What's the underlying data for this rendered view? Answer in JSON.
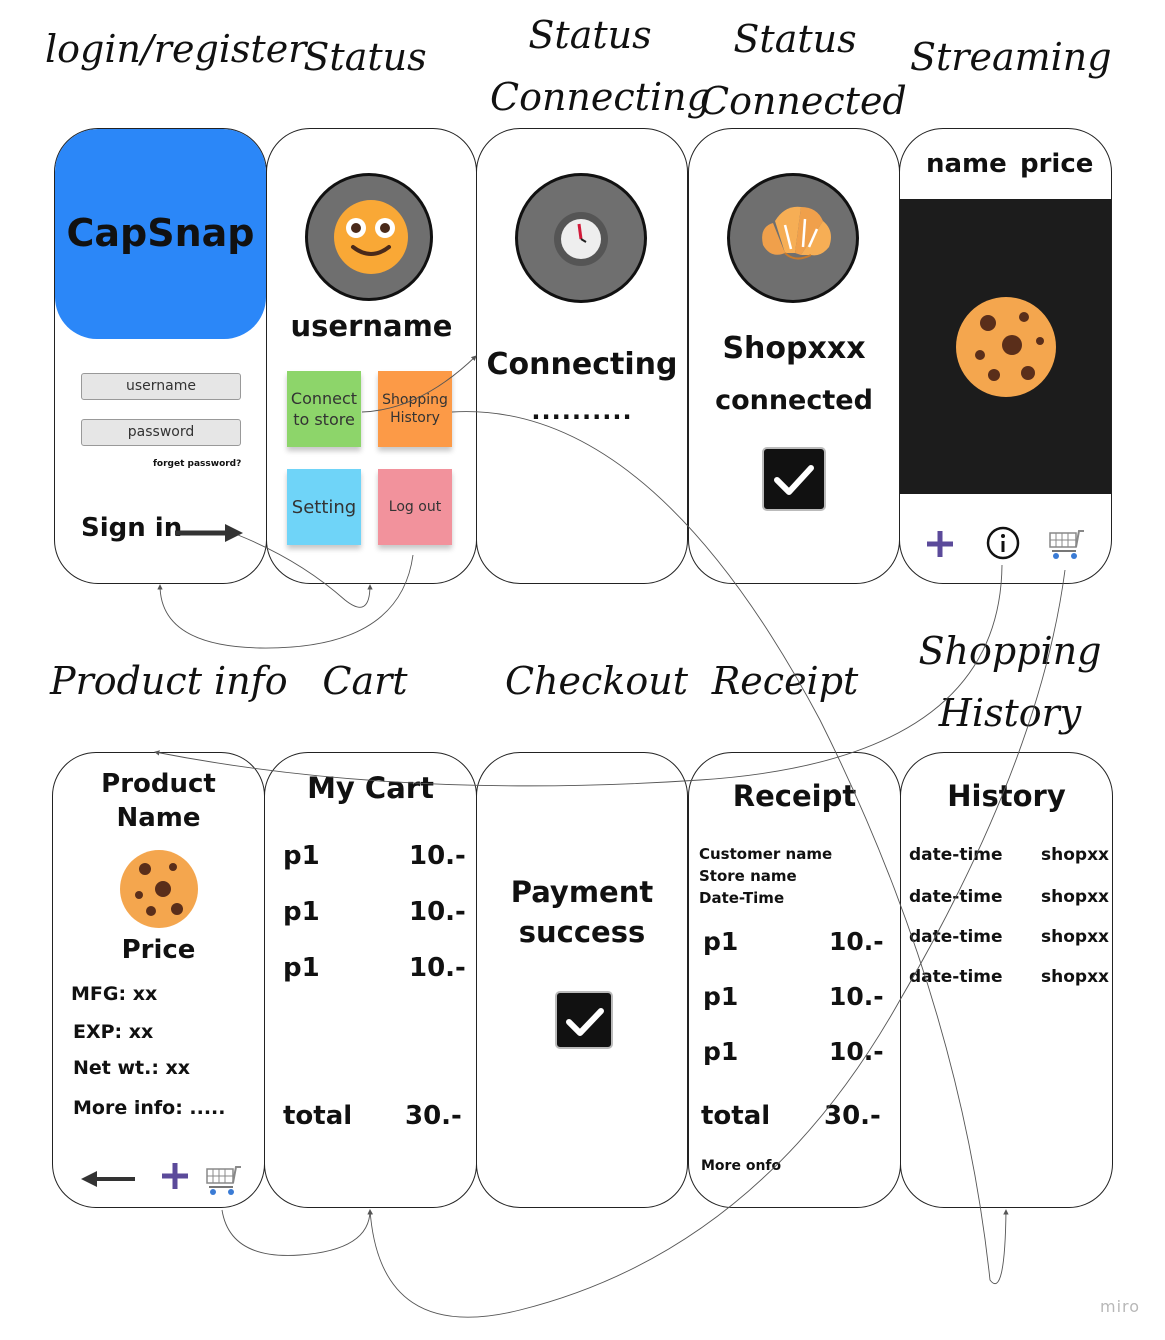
{
  "titles": {
    "login": "login/register",
    "status": "Status",
    "connecting": [
      "Status",
      "Connecting"
    ],
    "connected": [
      "Status",
      "Connected"
    ],
    "streaming": "Streaming",
    "product_info": "Product info",
    "cart": "Cart",
    "checkout": "Checkout",
    "receipt": "Receipt",
    "history": [
      "Shopping",
      "History"
    ]
  },
  "login": {
    "brand": "CapSnap",
    "username_placeholder": "username",
    "password_placeholder": "password",
    "forget": "forget password?",
    "sign_in": "Sign in",
    "brand_color": "#2b87f8"
  },
  "status": {
    "username": "username",
    "notes": [
      {
        "label_lines": [
          "Connect",
          "to store"
        ],
        "color": "#8dd56a"
      },
      {
        "label_lines": [
          "Shopping",
          "History"
        ],
        "color": "#fc9a47"
      },
      {
        "label_lines": [
          "Setting"
        ],
        "color": "#6fd4f8"
      },
      {
        "label_lines": [
          "Log out"
        ],
        "color": "#f2929c"
      }
    ]
  },
  "connecting": {
    "text": "Connecting",
    "dots": ".........."
  },
  "connected": {
    "shop": "Shopxxx",
    "text": "connected"
  },
  "streaming": {
    "name": "name",
    "price": "price",
    "icons": [
      "plus-icon",
      "info-icon",
      "cart-icon"
    ]
  },
  "product": {
    "title_lines": [
      "Product",
      "Name"
    ],
    "price": "Price",
    "mfg": "MFG: xx",
    "exp": "EXP: xx",
    "net": "Net wt.: xx",
    "more": "More info: ....."
  },
  "cart": {
    "title": "My Cart",
    "items": [
      {
        "name": "p1",
        "price": "10.-"
      },
      {
        "name": "p1",
        "price": "10.-"
      },
      {
        "name": "p1",
        "price": "10.-"
      }
    ],
    "total_label": "total",
    "total_value": "30.-"
  },
  "checkout": {
    "lines": [
      "Payment",
      "success"
    ]
  },
  "receipt": {
    "title": "Receipt",
    "meta": [
      "Customer name",
      "Store name",
      "Date-Time"
    ],
    "items": [
      {
        "name": "p1",
        "price": "10.-"
      },
      {
        "name": "p1",
        "price": "10.-"
      },
      {
        "name": "p1",
        "price": "10.-"
      }
    ],
    "total_label": "total",
    "total_value": "30.-",
    "more": "More onfo"
  },
  "history": {
    "title": "History",
    "rows": [
      {
        "date": "date-time",
        "shop": "shopxx"
      },
      {
        "date": "date-time",
        "shop": "shopxx"
      },
      {
        "date": "date-time",
        "shop": "shopxx"
      },
      {
        "date": "date-time",
        "shop": "shopxx"
      }
    ]
  },
  "watermark": "miro"
}
